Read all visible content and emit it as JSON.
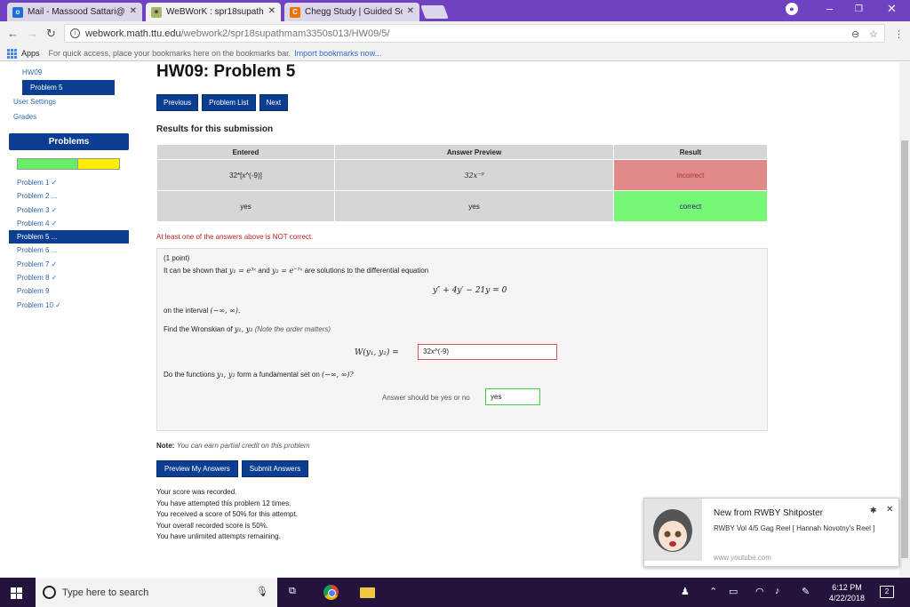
{
  "browser": {
    "tabs": [
      {
        "label": "Mail - Massood Sattari@",
        "icon": "outlook-icon"
      },
      {
        "label": "WeBWorK : spr18supathr",
        "icon": "webwork-icon"
      },
      {
        "label": "Chegg Study | Guided So",
        "icon": "chegg-icon"
      }
    ],
    "url_host": "webwork.math.ttu.edu",
    "url_path": "/webwork2/spr18supathmam3350s013/HW09/5/",
    "bookmarks": {
      "apps_label": "Apps",
      "hint": "For quick access, place your bookmarks here on the bookmarks bar.",
      "import_link": "Import bookmarks now..."
    }
  },
  "sidebar": {
    "set_link": "HW09",
    "current_problem": "Problem 5",
    "links": [
      "User Settings",
      "Grades"
    ],
    "problems_heading": "Problems",
    "progress": {
      "correct_fraction": 0.6,
      "partial_fraction": 0.4
    },
    "problem_list": [
      "Problem 1 ✓",
      "Problem 2 ...",
      "Problem 3 ✓",
      "Problem 4 ✓",
      "Problem 5 ...",
      "Problem 6 ...",
      "Problem 7 ✓",
      "Problem 8 ✓",
      "Problem 9",
      "Problem 10 ✓"
    ]
  },
  "main": {
    "title": "HW09: Problem 5",
    "nav": {
      "previous": "Previous",
      "list": "Problem List",
      "next": "Next"
    },
    "results_title": "Results for this submission",
    "results_headers": [
      "Entered",
      "Answer Preview",
      "Result"
    ],
    "results_rows": [
      {
        "entered": "32*[x^(-9)]",
        "preview": "32x⁻⁹",
        "result": "incorrect"
      },
      {
        "entered": "yes",
        "preview": "yes",
        "result": "correct"
      }
    ],
    "warning": "At least one of the answers above is NOT correct.",
    "problem": {
      "points": "(1 point)",
      "intro_a": "It can be shown that",
      "y1": "y₁ = e³ˣ",
      "intro_b": "and",
      "y2": "y₂ = e⁻⁷ˣ",
      "intro_c": "are solutions to the differential equation",
      "equation": "y″ + 4y′ − 21y = 0",
      "interval_text": "on the interval",
      "interval": "(−∞, ∞).",
      "wronskian_prompt": "Find the Wronskian of",
      "wronskian_vars": "y₁, y₂",
      "wronskian_note": "(Note the order matters)",
      "wronskian_label": "W(y₁, y₂) =",
      "answer1": "32x^(-9)",
      "fundamental_a": "Do the functions",
      "fundamental_vars": "y₁, y₂",
      "fundamental_b": "form a fundamental set on",
      "fundamental_interval": "(−∞, ∞)?",
      "answer2_label": "Answer should be yes or no",
      "answer2": "yes"
    },
    "note_label": "Note:",
    "note_text": "You can earn partial credit on this problem",
    "buttons": {
      "preview": "Preview My Answers",
      "submit": "Submit Answers"
    },
    "score_lines": [
      "Your score was recorded.",
      "You have attempted this problem 12 times.",
      "You received a score of 50% for this attempt.",
      "Your overall recorded score is 50%.",
      "You have unlimited attempts remaining."
    ]
  },
  "notification": {
    "title": "New from RWBY Shitposter",
    "body": "RWBY Vol 4/5 Gag Reel [ Hannah Novotny's Reel ]",
    "site": "www.youtube.com"
  },
  "taskbar": {
    "search_placeholder": "Type here to search",
    "time": "6:12 PM",
    "date": "4/22/2018",
    "notification_count": "2"
  },
  "colors": {
    "accent": "#0b3d91",
    "chrome": "#6f42c1",
    "incorrect": "#e08a8a",
    "correct": "#77f777"
  }
}
